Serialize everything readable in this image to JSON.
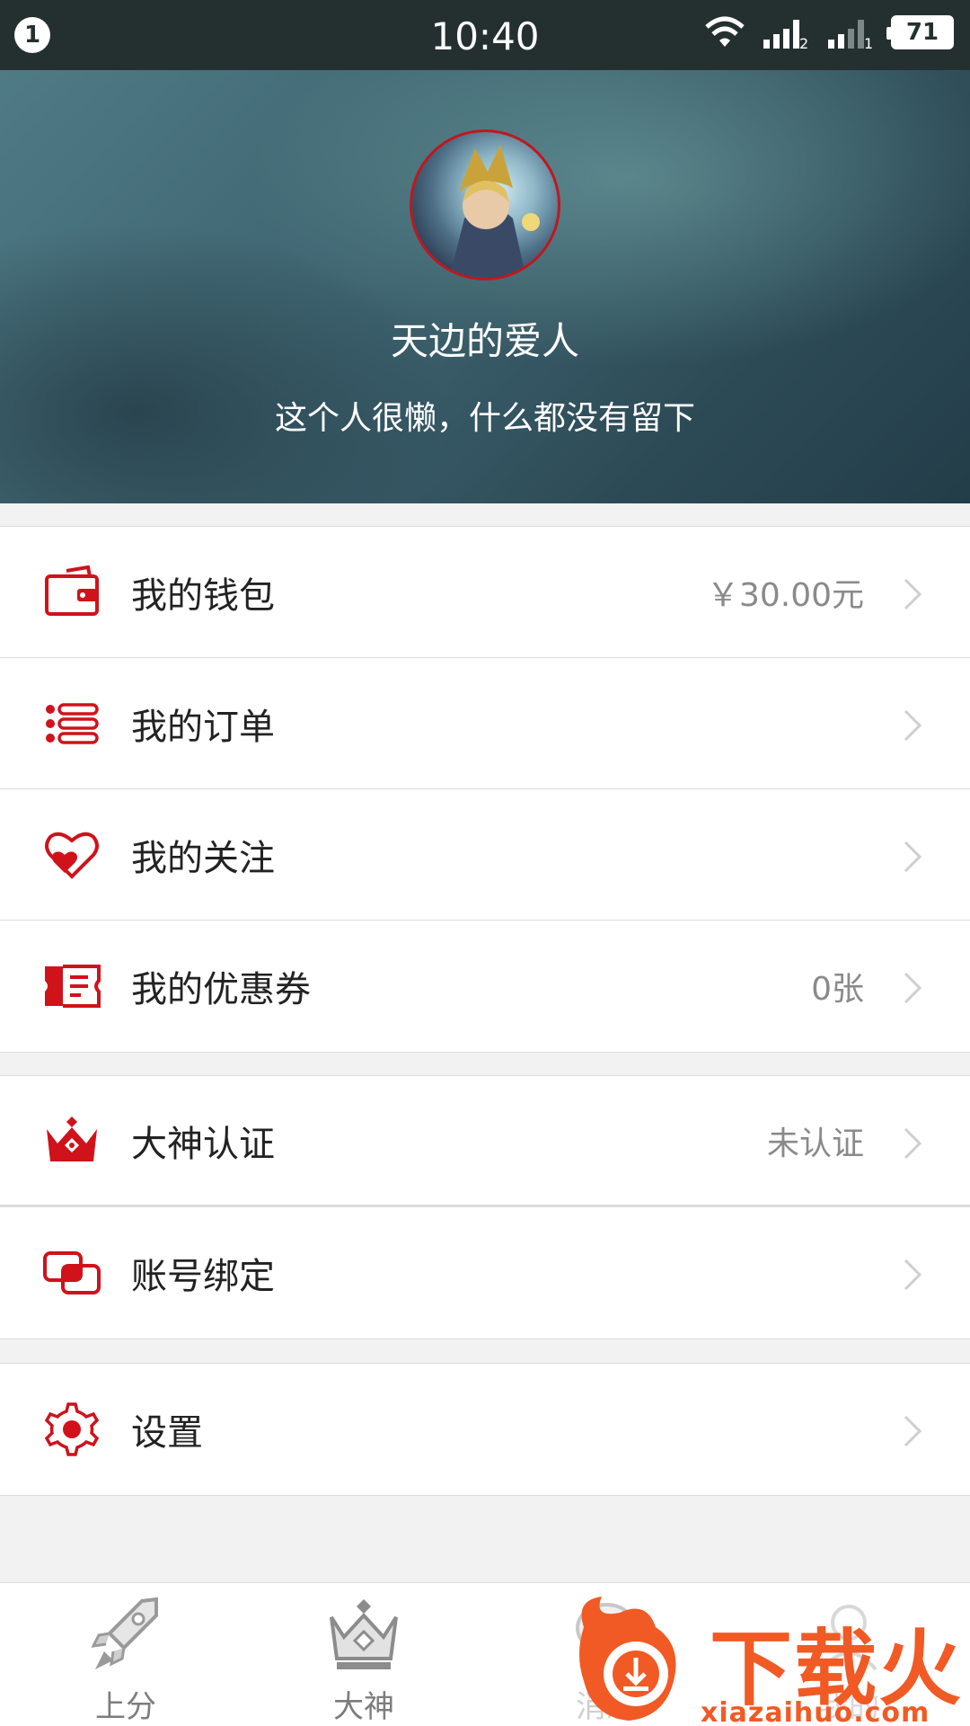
{
  "status_bar": {
    "notification_count": "1",
    "time": "10:40",
    "sim1_label": "2",
    "sim2_label": "1",
    "battery": "71",
    "icons": [
      "wifi-icon",
      "signal-icon",
      "signal-icon",
      "battery-icon"
    ]
  },
  "profile": {
    "name": "天边的爱人",
    "bio": "这个人很懒，什么都没有留下"
  },
  "menu": {
    "wallet": {
      "label": "我的钱包",
      "value": "￥30.00元",
      "icon": "wallet-icon"
    },
    "orders": {
      "label": "我的订单",
      "icon": "list-icon"
    },
    "follows": {
      "label": "我的关注",
      "icon": "heart-icon"
    },
    "coupons": {
      "label": "我的优惠券",
      "value": "0张",
      "icon": "ticket-icon"
    },
    "certification": {
      "label": "大神认证",
      "value": "未认证",
      "icon": "crown-icon"
    },
    "binding": {
      "label": "账号绑定",
      "icon": "link-icon"
    },
    "settings": {
      "label": "设置",
      "icon": "gear-icon"
    }
  },
  "tabs": [
    {
      "label": "上分",
      "icon": "rocket-icon"
    },
    {
      "label": "大神",
      "icon": "crown-icon"
    },
    {
      "label": "消息",
      "icon": "chat-icon"
    },
    {
      "label": "我的",
      "icon": "user-icon"
    }
  ],
  "watermark": {
    "text": "下载火",
    "url": "xiazaihuo.com"
  },
  "colors": {
    "accent": "#d0121b",
    "status_bar": "#24302f",
    "watermark": "#f15a24"
  }
}
